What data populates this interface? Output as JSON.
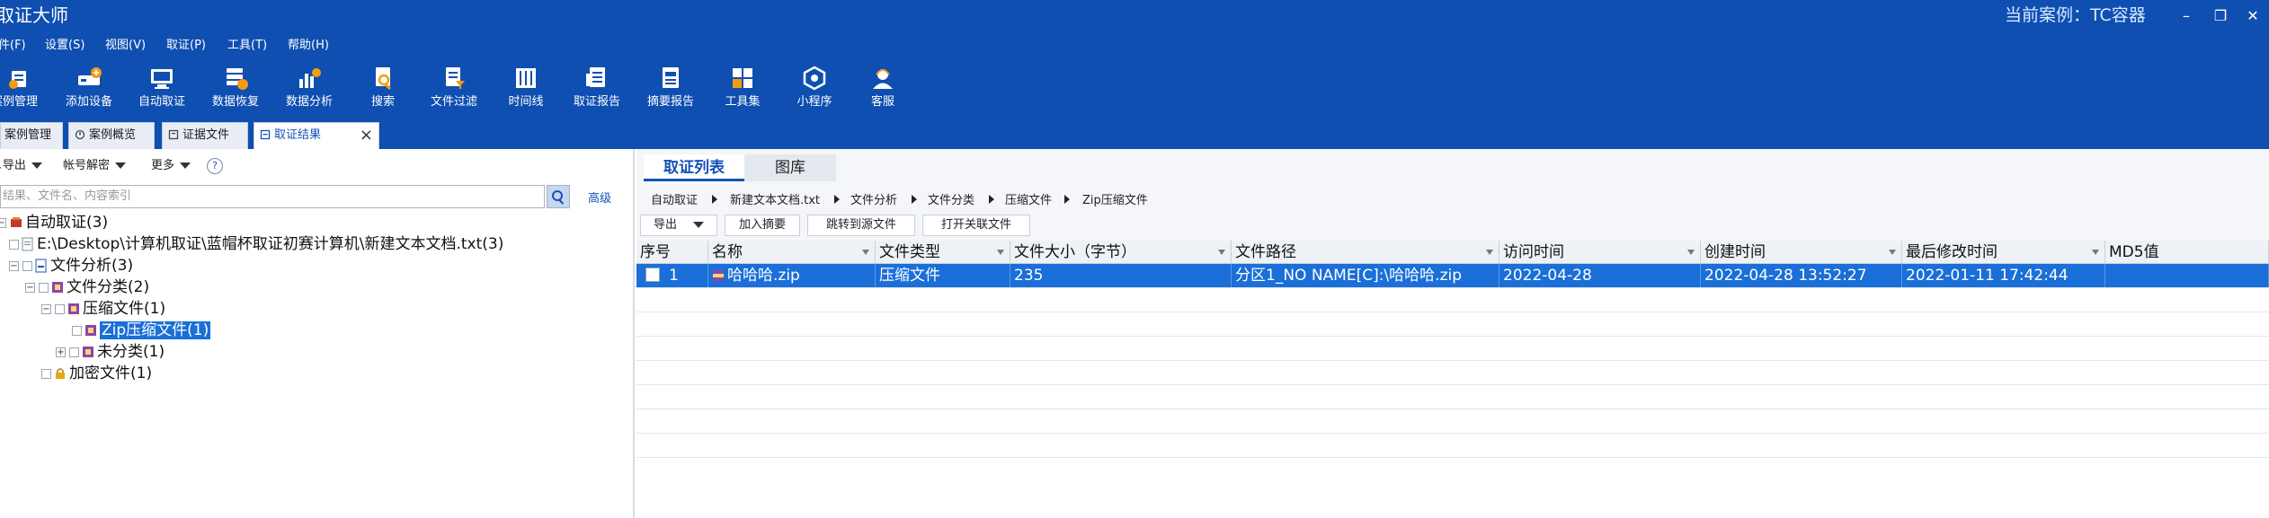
{
  "window": {
    "title": "取证大师",
    "current_case_label": "当前案例：TC容器",
    "buttons": {
      "minimize": "–",
      "restore": "❐",
      "close": "✕"
    }
  },
  "menu": [
    "件(F)",
    "设置(S)",
    "视图(V)",
    "取证(P)",
    "工具(T)",
    "帮助(H)"
  ],
  "toolbar": [
    {
      "label": "案例管理",
      "icon": "case-management-icon"
    },
    {
      "label": "添加设备",
      "icon": "add-device-icon"
    },
    {
      "label": "自动取证",
      "icon": "auto-forensics-icon"
    },
    {
      "label": "数据恢复",
      "icon": "data-recovery-icon"
    },
    {
      "label": "数据分析",
      "icon": "data-analysis-icon"
    },
    {
      "label": "搜索",
      "icon": "search-icon"
    },
    {
      "label": "文件过滤",
      "icon": "file-filter-icon"
    },
    {
      "label": "时间线",
      "icon": "timeline-icon"
    },
    {
      "label": "取证报告",
      "icon": "forensics-report-icon"
    },
    {
      "label": "摘要报告",
      "icon": "summary-report-icon"
    },
    {
      "label": "工具集",
      "icon": "toolset-icon"
    },
    {
      "label": "小程序",
      "icon": "mini-program-icon"
    },
    {
      "label": "客服",
      "icon": "customer-service-icon"
    }
  ],
  "tabs": [
    {
      "label": "案例管理",
      "active": false
    },
    {
      "label": "案例概览",
      "active": false
    },
    {
      "label": "证据文件",
      "active": false
    },
    {
      "label": "取证结果",
      "active": true
    }
  ],
  "left_panel": {
    "export_label": "导出",
    "account_decrypt_label": "帐号解密",
    "more_label": "更多",
    "help_label": "?",
    "search_placeholder": "结果、文件名、内容索引",
    "advanced_label": "高级",
    "tree": [
      {
        "label": "自动取证(3)"
      },
      {
        "label": "E:\\Desktop\\计算机取证\\蓝帽杯取证初赛计算机\\新建文本文档.txt(3)"
      },
      {
        "label": "文件分析(3)"
      },
      {
        "label": "文件分类(2)"
      },
      {
        "label": "压缩文件(1)"
      },
      {
        "label": "Zip压缩文件(1)",
        "selected": true
      },
      {
        "label": "未分类(1)"
      },
      {
        "label": "加密文件(1)"
      }
    ]
  },
  "right_panel": {
    "tabs": [
      {
        "label": "取证列表",
        "active": true
      },
      {
        "label": "图库",
        "active": false
      }
    ],
    "breadcrumb": [
      "自动取证",
      "新建文本文档.txt",
      "文件分析",
      "文件分类",
      "压缩文件",
      "Zip压缩文件"
    ],
    "actions": {
      "export": "导出",
      "add_digest": "加入摘要",
      "jump_source": "跳转到源文件",
      "open_related": "打开关联文件"
    },
    "columns": [
      "序号",
      "名称",
      "文件类型",
      "文件大小（字节）",
      "文件路径",
      "访问时间",
      "创建时间",
      "最后修改时间",
      "MD5值"
    ],
    "rows": [
      {
        "index": "1",
        "name": "哈哈哈.zip",
        "type": "压缩文件",
        "size": "235",
        "path": "分区1_NO NAME[C]:\\哈哈哈.zip",
        "accessed": "2022-04-28",
        "created": "2022-04-28 13:52:27",
        "modified": "2022-01-11 17:42:44",
        "md5": ""
      }
    ]
  },
  "colors": {
    "brand_blue": "#0f4fb1",
    "selection_blue": "#1a6fd8",
    "link_blue": "#1553b7"
  }
}
